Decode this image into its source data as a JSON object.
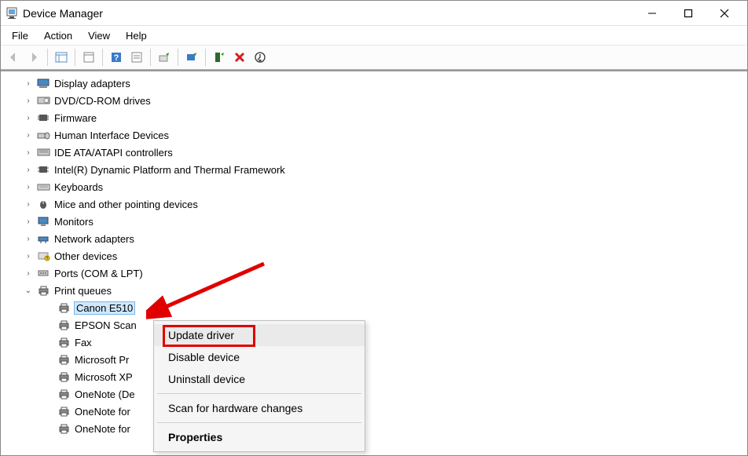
{
  "window": {
    "title": "Device Manager"
  },
  "menu": {
    "file": "File",
    "action": "Action",
    "view": "View",
    "help": "Help"
  },
  "tree": {
    "display_adapters": "Display adapters",
    "dvd_cd": "DVD/CD-ROM drives",
    "firmware": "Firmware",
    "hid": "Human Interface Devices",
    "ide": "IDE ATA/ATAPI controllers",
    "intel_dptf": "Intel(R) Dynamic Platform and Thermal Framework",
    "keyboards": "Keyboards",
    "mice": "Mice and other pointing devices",
    "monitors": "Monitors",
    "network_adapters": "Network adapters",
    "other_devices": "Other devices",
    "ports": "Ports (COM & LPT)",
    "print_queues": "Print queues",
    "printers": {
      "canon": "Canon E510",
      "epson": "EPSON Scan",
      "fax": "Fax",
      "ms_pr": "Microsoft Pr",
      "ms_xp": "Microsoft XP",
      "onenote_de": "OneNote (De",
      "onenote_for1": "OneNote for",
      "onenote_for2": "OneNote for"
    }
  },
  "context_menu": {
    "update_driver": "Update driver",
    "disable_device": "Disable device",
    "uninstall_device": "Uninstall device",
    "scan_changes": "Scan for hardware changes",
    "properties": "Properties"
  }
}
